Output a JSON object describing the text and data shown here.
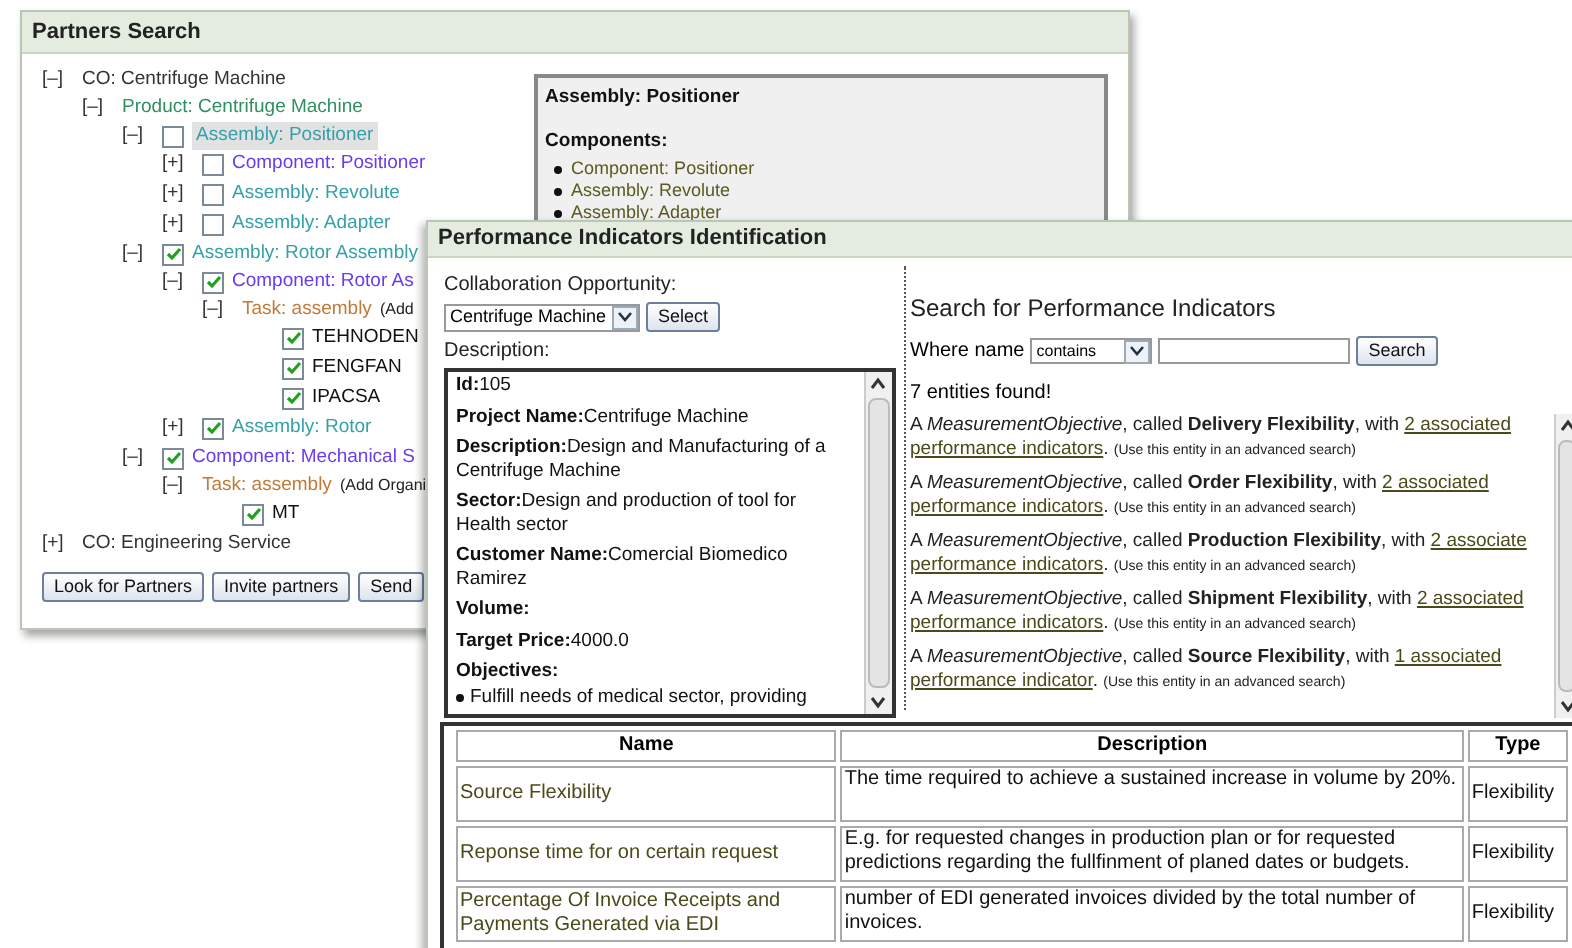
{
  "partners_window": {
    "title": "Partners Search",
    "tree": [
      {
        "kind": "co",
        "toggle": "[–]",
        "label": "CO: Centrifuge Machine",
        "selected": false,
        "children": [
          {
            "kind": "product",
            "toggle": "[–]",
            "label": "Product: Centrifuge Machine",
            "selected": false,
            "children": [
              {
                "kind": "assembly",
                "toggle": "[–]",
                "checked": false,
                "label": "Assembly: Positioner",
                "selected": true,
                "children": [
                  {
                    "kind": "component",
                    "toggle": "[+]",
                    "checked": false,
                    "label": "Component: Positioner",
                    "selected": false
                  },
                  {
                    "kind": "assembly",
                    "toggle": "[+]",
                    "checked": false,
                    "label": "Assembly: Revolute",
                    "selected": false
                  },
                  {
                    "kind": "assembly",
                    "toggle": "[+]",
                    "checked": false,
                    "label": "Assembly: Adapter",
                    "selected": false
                  }
                ]
              },
              {
                "kind": "assembly",
                "toggle": "[–]",
                "checked": true,
                "label": "Assembly: Rotor Assembly",
                "selected": false,
                "children": [
                  {
                    "kind": "component",
                    "toggle": "[–]",
                    "checked": true,
                    "label": "Component: Rotor As",
                    "selected": false,
                    "children": [
                      {
                        "kind": "task",
                        "toggle": "[–]",
                        "label": "Task: assembly",
                        "note": "(Add",
                        "selected": false,
                        "children": [
                          {
                            "kind": "partner",
                            "checked": true,
                            "label": "TEHNODEN",
                            "selected": false
                          },
                          {
                            "kind": "partner",
                            "checked": true,
                            "label": "FENGFAN",
                            "selected": false
                          },
                          {
                            "kind": "partner",
                            "checked": true,
                            "label": "IPACSA",
                            "selected": false
                          }
                        ]
                      }
                    ]
                  },
                  {
                    "kind": "assembly",
                    "toggle": "[+]",
                    "checked": true,
                    "label": "Assembly: Rotor",
                    "selected": false
                  }
                ]
              },
              {
                "kind": "component",
                "toggle": "[–]",
                "checked": true,
                "label": "Component: Mechanical S",
                "selected": false,
                "children": [
                  {
                    "kind": "task",
                    "toggle": "[–]",
                    "label": "Task: assembly",
                    "note": "(Add Organi",
                    "selected": false,
                    "children": [
                      {
                        "kind": "partner",
                        "checked": true,
                        "label": "MT",
                        "selected": false
                      }
                    ]
                  }
                ]
              }
            ]
          }
        ]
      },
      {
        "kind": "co",
        "toggle": "[+]",
        "label": "CO: Engineering Service",
        "selected": false
      }
    ],
    "buttons": [
      "Look for Partners",
      "Invite partners",
      "Send"
    ],
    "detail": {
      "title": "Assembly: Positioner",
      "section": "Components:",
      "items": [
        "Component: Positioner",
        "Assembly: Revolute",
        "Assembly: Adapter"
      ]
    }
  },
  "indicators_window": {
    "title": "Performance Indicators Identification",
    "opportunity_label": "Collaboration Opportunity:",
    "opportunity_select": "Centrifuge Machine",
    "select_button": "Select",
    "description_label": "Description:",
    "description": [
      {
        "label": "Id:",
        "value": "105"
      },
      {
        "label": "Project Name:",
        "value": "Centrifuge Machine"
      },
      {
        "label": "Description:",
        "value": "Design and Manufacturing of a Centrifuge Machine"
      },
      {
        "label": "Sector:",
        "value": "Design and production of tool for Health sector"
      },
      {
        "label": "Customer Name:",
        "value": "Comercial Biomedico Ramirez"
      },
      {
        "label": "Volume:"
      },
      {
        "label": "Target Price:",
        "value": "4000.0"
      },
      {
        "label": "Objectives:"
      }
    ],
    "objectives": [
      "Fulfill needs of medical sector, providing"
    ],
    "search": {
      "title": "Search for Performance Indicators",
      "where_label": "Where name",
      "operator": "contains",
      "button": "Search",
      "found": "7 entities found!"
    },
    "results": [
      {
        "text": "A *MeasurementObjective*, called **Delivery Flexibility**, with ",
        "link": [
          "2 associated",
          "performance indicators"
        ],
        "after": ".",
        "note": "(Use this entity in an advanced search)"
      },
      {
        "text": "A *MeasurementObjective*, called **Order Flexibility**, with ",
        "link": [
          "2 associated",
          "performance indicators"
        ],
        "after": ".",
        "note": "(Use this entity in an advanced search)"
      },
      {
        "text": "A *MeasurementObjective*, called **Production Flexibility**, with ",
        "link": [
          "2 associate",
          "performance indicators"
        ],
        "after": ".",
        "note": "(Use this entity in an advanced search)"
      },
      {
        "text": "A *MeasurementObjective*, called **Shipment Flexibility**, with ",
        "link": [
          "2 associated",
          "performance indicators"
        ],
        "after": ".",
        "note": "(Use this entity in an advanced search)"
      },
      {
        "text": "A *MeasurementObjective*, called **Source Flexibility**, with ",
        "link": [
          "1 associated",
          "performance indicator"
        ],
        "after": ".",
        "note": "(Use this entity in an advanced search)"
      }
    ],
    "table": {
      "columns": [
        "Name",
        "Description",
        "Type"
      ],
      "rows": [
        [
          "Source Flexibility",
          "The time required to achieve a sustained increase in volume by 20%.",
          "Flexibility"
        ],
        [
          "Reponse time for on certain request",
          "E.g. for requested changes in production plan or for requested predictions regarding the fullfinment of planed dates or budgets.",
          "Flexibility"
        ],
        [
          "Percentage Of Invoice Receipts and Payments Generated via EDI",
          "number of EDI generated invoices divided by the total number of invoices.",
          "Flexibility"
        ]
      ]
    }
  }
}
